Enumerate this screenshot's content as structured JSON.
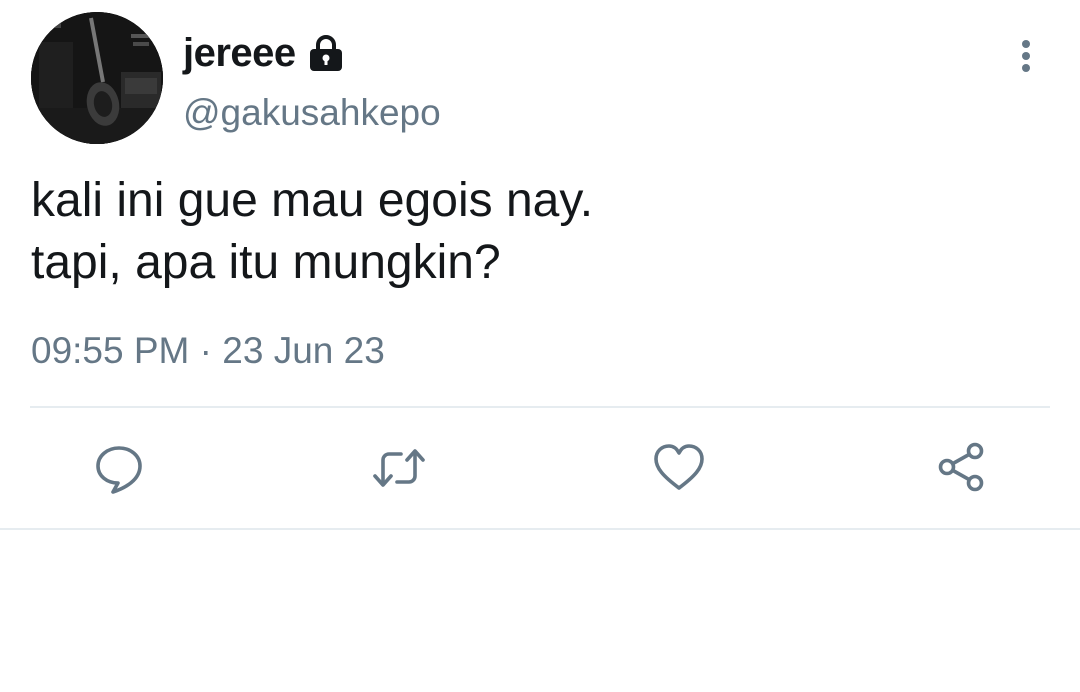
{
  "tweet": {
    "author": {
      "display_name": "jereee",
      "handle": "@gakusahkepo",
      "protected_icon": "lock-icon",
      "avatar": "guitar-photo-avatar"
    },
    "text_lines": [
      "kali ini gue mau egois nay.",
      "tapi, apa itu mungkin?"
    ],
    "time": "09:55 PM",
    "separator": "·",
    "date": "23 Jun 23",
    "menu_icon": "more-vertical-icon",
    "actions": [
      {
        "icon": "reply-icon"
      },
      {
        "icon": "retweet-icon"
      },
      {
        "icon": "like-icon"
      },
      {
        "icon": "share-icon"
      }
    ]
  },
  "colors": {
    "text_primary": "#14171a",
    "text_secondary": "#657786",
    "icon": "#657786",
    "divider": "#e6ecf0"
  }
}
